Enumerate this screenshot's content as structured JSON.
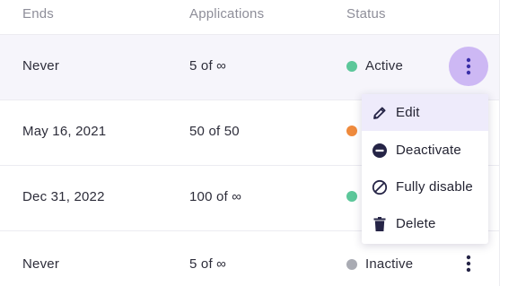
{
  "table": {
    "headers": {
      "ends": "Ends",
      "applications": "Applications",
      "status": "Status"
    },
    "rows": [
      {
        "ends": "Never",
        "applications": "5 of ∞",
        "status": "Active",
        "status_color": "#5cc79a"
      },
      {
        "ends": "May 16, 2021",
        "applications": "50 of 50",
        "status": "",
        "status_color": "#ef8a3c"
      },
      {
        "ends": "Dec 31, 2022",
        "applications": "100 of ∞",
        "status": "",
        "status_color": "#5cc79a"
      },
      {
        "ends": "Never",
        "applications": "5 of ∞",
        "status": "Inactive",
        "status_color": "#a9abb3"
      }
    ]
  },
  "actions_menu": {
    "items": [
      {
        "label": "Edit",
        "icon": "pencil-icon"
      },
      {
        "label": "Deactivate",
        "icon": "minus-circle-icon"
      },
      {
        "label": "Fully disable",
        "icon": "prohibited-icon"
      },
      {
        "label": "Delete",
        "icon": "trash-icon"
      }
    ]
  },
  "colors": {
    "accent": "#cdb8f4",
    "icon_dark": "#252446",
    "row_highlight": "#f6f5fb",
    "menu_hover": "#eeebfb"
  }
}
